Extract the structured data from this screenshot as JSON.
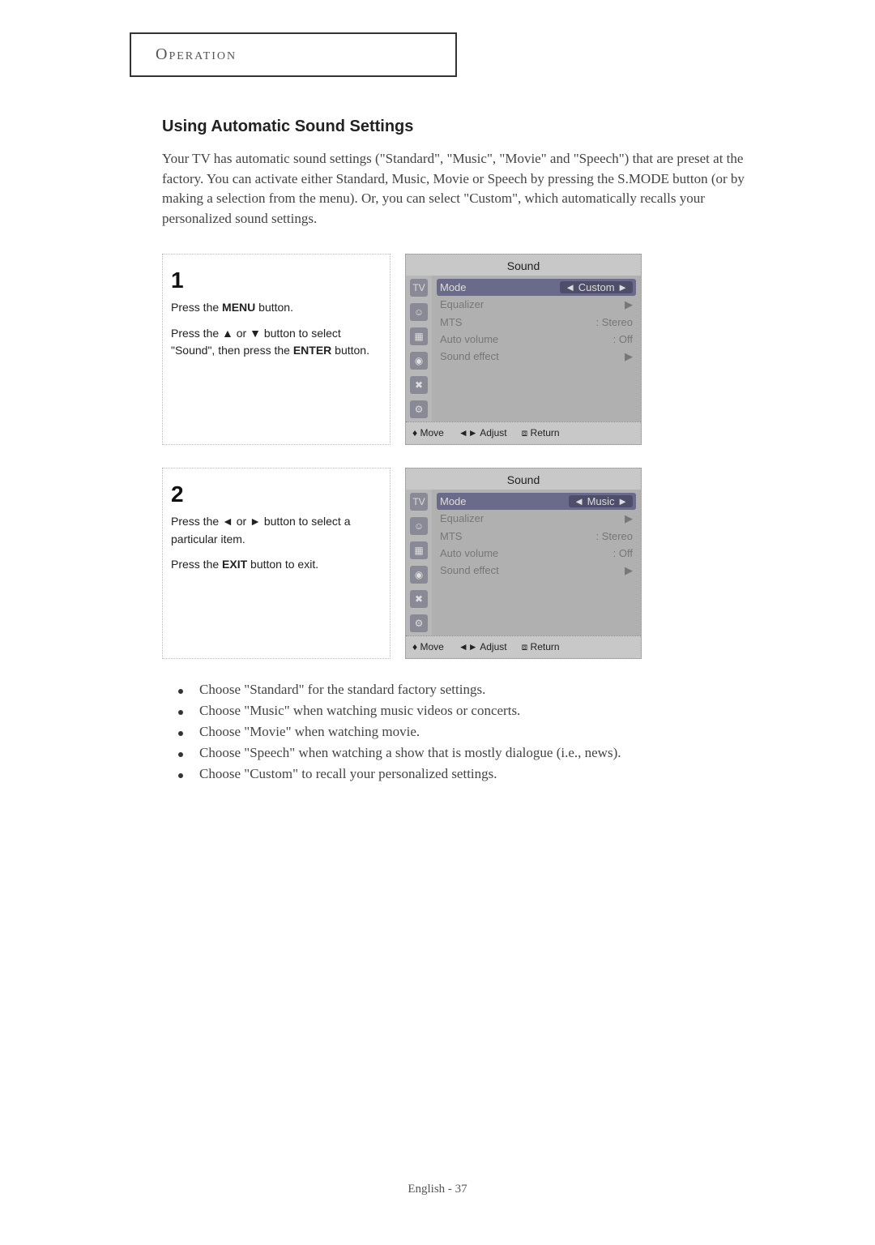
{
  "header": "Operation",
  "title": "Using Automatic Sound Settings",
  "intro": "Your TV has automatic sound settings (\"Standard\", \"Music\", \"Movie\" and \"Speech\")  that are preset at the factory.  You can activate either Standard, Music, Movie or Speech by pressing the S.MODE button (or by making a selection from the menu). Or, you can select \"Custom\", which automatically recalls your personalized sound settings.",
  "steps": [
    {
      "num": "1",
      "lines": [
        "Press the <b>MENU</b> button.",
        "Press the ▲ or ▼ button to select \"Sound\", then press the <b>ENTER</b> button."
      ],
      "osd": {
        "title": "Sound",
        "rows": [
          {
            "label": "Mode",
            "value": "◄ Custom ►",
            "sel": true
          },
          {
            "label": "Equalizer",
            "value": "▶"
          },
          {
            "label": "MTS",
            "value": ": Stereo"
          },
          {
            "label": "Auto volume",
            "value": ": Off"
          },
          {
            "label": "Sound effect",
            "value": "▶"
          }
        ],
        "foot": [
          "♦ Move",
          "◄► Adjust",
          "⧈ Return"
        ]
      }
    },
    {
      "num": "2",
      "lines": [
        "Press the ◄ or ► button to select a particular item.",
        "Press the <b>EXIT</b> button to exit."
      ],
      "osd": {
        "title": "Sound",
        "rows": [
          {
            "label": "Mode",
            "value": "◄ Music ►",
            "sel": true
          },
          {
            "label": "Equalizer",
            "value": "▶"
          },
          {
            "label": "MTS",
            "value": ": Stereo"
          },
          {
            "label": "Auto volume",
            "value": ": Off"
          },
          {
            "label": "Sound effect",
            "value": "▶"
          }
        ],
        "foot": [
          "♦ Move",
          "◄► Adjust",
          "⧈ Return"
        ]
      }
    }
  ],
  "bullets": [
    "Choose \"Standard\" for the standard factory settings.",
    "Choose \"Music\" when watching music videos or concerts.",
    "Choose \"Movie\" when watching movie.",
    "Choose \"Speech\" when watching a show that is mostly dialogue (i.e., news).",
    "Choose \"Custom\" to recall your personalized settings."
  ],
  "footer": "English - 37"
}
